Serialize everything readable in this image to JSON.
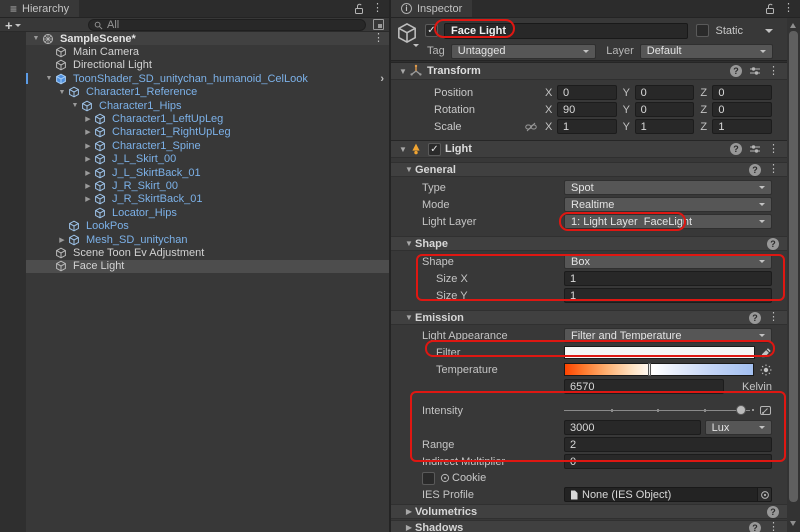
{
  "colors": {
    "panel_bg": "#383838",
    "prefab_blue": "#7cb1e8",
    "selection_gray": "#4d4d4d",
    "annotation_red": "#df1712",
    "temperature_gradient_left": "#ff4400",
    "temperature_gradient_right": "#a3c0f1",
    "filter_swatch": "#f4f4f4",
    "light_icon_orange": "#f0a431"
  },
  "hierarchy": {
    "tab_label": "Hierarchy",
    "add_button": "+",
    "search_placeholder": "All",
    "items": [
      {
        "label": "SampleScene*",
        "depth": 0,
        "icon": "scene",
        "tone": "white",
        "arrow": "open",
        "header": true,
        "kebab": true
      },
      {
        "label": "Main Camera",
        "depth": 1,
        "icon": "cube",
        "tone": "white",
        "arrow": "none"
      },
      {
        "label": "Directional Light",
        "depth": 1,
        "icon": "cube",
        "tone": "white",
        "arrow": "none"
      },
      {
        "label": "ToonShader_SD_unitychan_humanoid_CelLook",
        "depth": 1,
        "icon": "prefab",
        "tone": "blue",
        "arrow": "open",
        "prefab_bar": true,
        "chevron": true
      },
      {
        "label": "Character1_Reference",
        "depth": 2,
        "icon": "cube",
        "tone": "blue",
        "arrow": "open"
      },
      {
        "label": "Character1_Hips",
        "depth": 3,
        "icon": "cube",
        "tone": "blue",
        "arrow": "open"
      },
      {
        "label": "Character1_LeftUpLeg",
        "depth": 4,
        "icon": "cube",
        "tone": "blue",
        "arrow": "closed"
      },
      {
        "label": "Character1_RightUpLeg",
        "depth": 4,
        "icon": "cube",
        "tone": "blue",
        "arrow": "closed"
      },
      {
        "label": "Character1_Spine",
        "depth": 4,
        "icon": "cube",
        "tone": "blue",
        "arrow": "closed"
      },
      {
        "label": "J_L_Skirt_00",
        "depth": 4,
        "icon": "cube",
        "tone": "blue",
        "arrow": "closed"
      },
      {
        "label": "J_L_SkirtBack_01",
        "depth": 4,
        "icon": "cube",
        "tone": "blue",
        "arrow": "closed"
      },
      {
        "label": "J_R_Skirt_00",
        "depth": 4,
        "icon": "cube",
        "tone": "blue",
        "arrow": "closed"
      },
      {
        "label": "J_R_SkirtBack_01",
        "depth": 4,
        "icon": "cube",
        "tone": "blue",
        "arrow": "closed"
      },
      {
        "label": "Locator_Hips",
        "depth": 4,
        "icon": "cube",
        "tone": "blue",
        "arrow": "none"
      },
      {
        "label": "LookPos",
        "depth": 2,
        "icon": "cube",
        "tone": "blue",
        "arrow": "none"
      },
      {
        "label": "Mesh_SD_unitychan",
        "depth": 2,
        "icon": "cube",
        "tone": "blue",
        "arrow": "closed"
      },
      {
        "label": "Scene Toon Ev Adjustment",
        "depth": 1,
        "icon": "cube",
        "tone": "white",
        "arrow": "none"
      },
      {
        "label": "Face Light",
        "depth": 1,
        "icon": "cube",
        "tone": "white",
        "arrow": "none",
        "selected": true
      }
    ]
  },
  "inspector": {
    "tab_label": "Inspector",
    "header": {
      "name": "Face Light",
      "static_label": "Static",
      "tag_label": "Tag",
      "tag_value": "Untagged",
      "layer_label": "Layer",
      "layer_value": "Default"
    },
    "transform": {
      "title": "Transform",
      "position_label": "Position",
      "rotation_label": "Rotation",
      "scale_label": "Scale",
      "axis_x": "X",
      "axis_y": "Y",
      "axis_z": "Z",
      "position": {
        "x": "0",
        "y": "0",
        "z": "0"
      },
      "rotation": {
        "x": "90",
        "y": "0",
        "z": "0"
      },
      "scale": {
        "x": "1",
        "y": "1",
        "z": "1"
      }
    },
    "light": {
      "title": "Light",
      "general": {
        "title": "General",
        "type_label": "Type",
        "type_value": "Spot",
        "mode_label": "Mode",
        "mode_value": "Realtime",
        "light_layer_label": "Light Layer",
        "light_layer_value": "1: Light Layer  FaceLight"
      },
      "shape": {
        "title": "Shape",
        "shape_label": "Shape",
        "shape_value": "Box",
        "size_x_label": "Size X",
        "size_x_value": "1",
        "size_y_label": "Size Y",
        "size_y_value": "1"
      },
      "emission": {
        "title": "Emission",
        "appearance_label": "Light Appearance",
        "appearance_value": "Filter and Temperature",
        "filter_label": "Filter",
        "temperature_label": "Temperature",
        "temperature_value": "6570",
        "kelvin_label": "Kelvin",
        "intensity_label": "Intensity",
        "intensity_value": "3000",
        "intensity_unit": "Lux",
        "range_label": "Range",
        "range_value": "2",
        "indirect_label": "Indirect Multiplier",
        "indirect_value": "0",
        "cookie_label": "Cookie",
        "ies_label": "IES Profile",
        "ies_value": "None (IES Object)"
      },
      "volumetrics_title": "Volumetrics",
      "shadows_title": "Shadows"
    }
  }
}
